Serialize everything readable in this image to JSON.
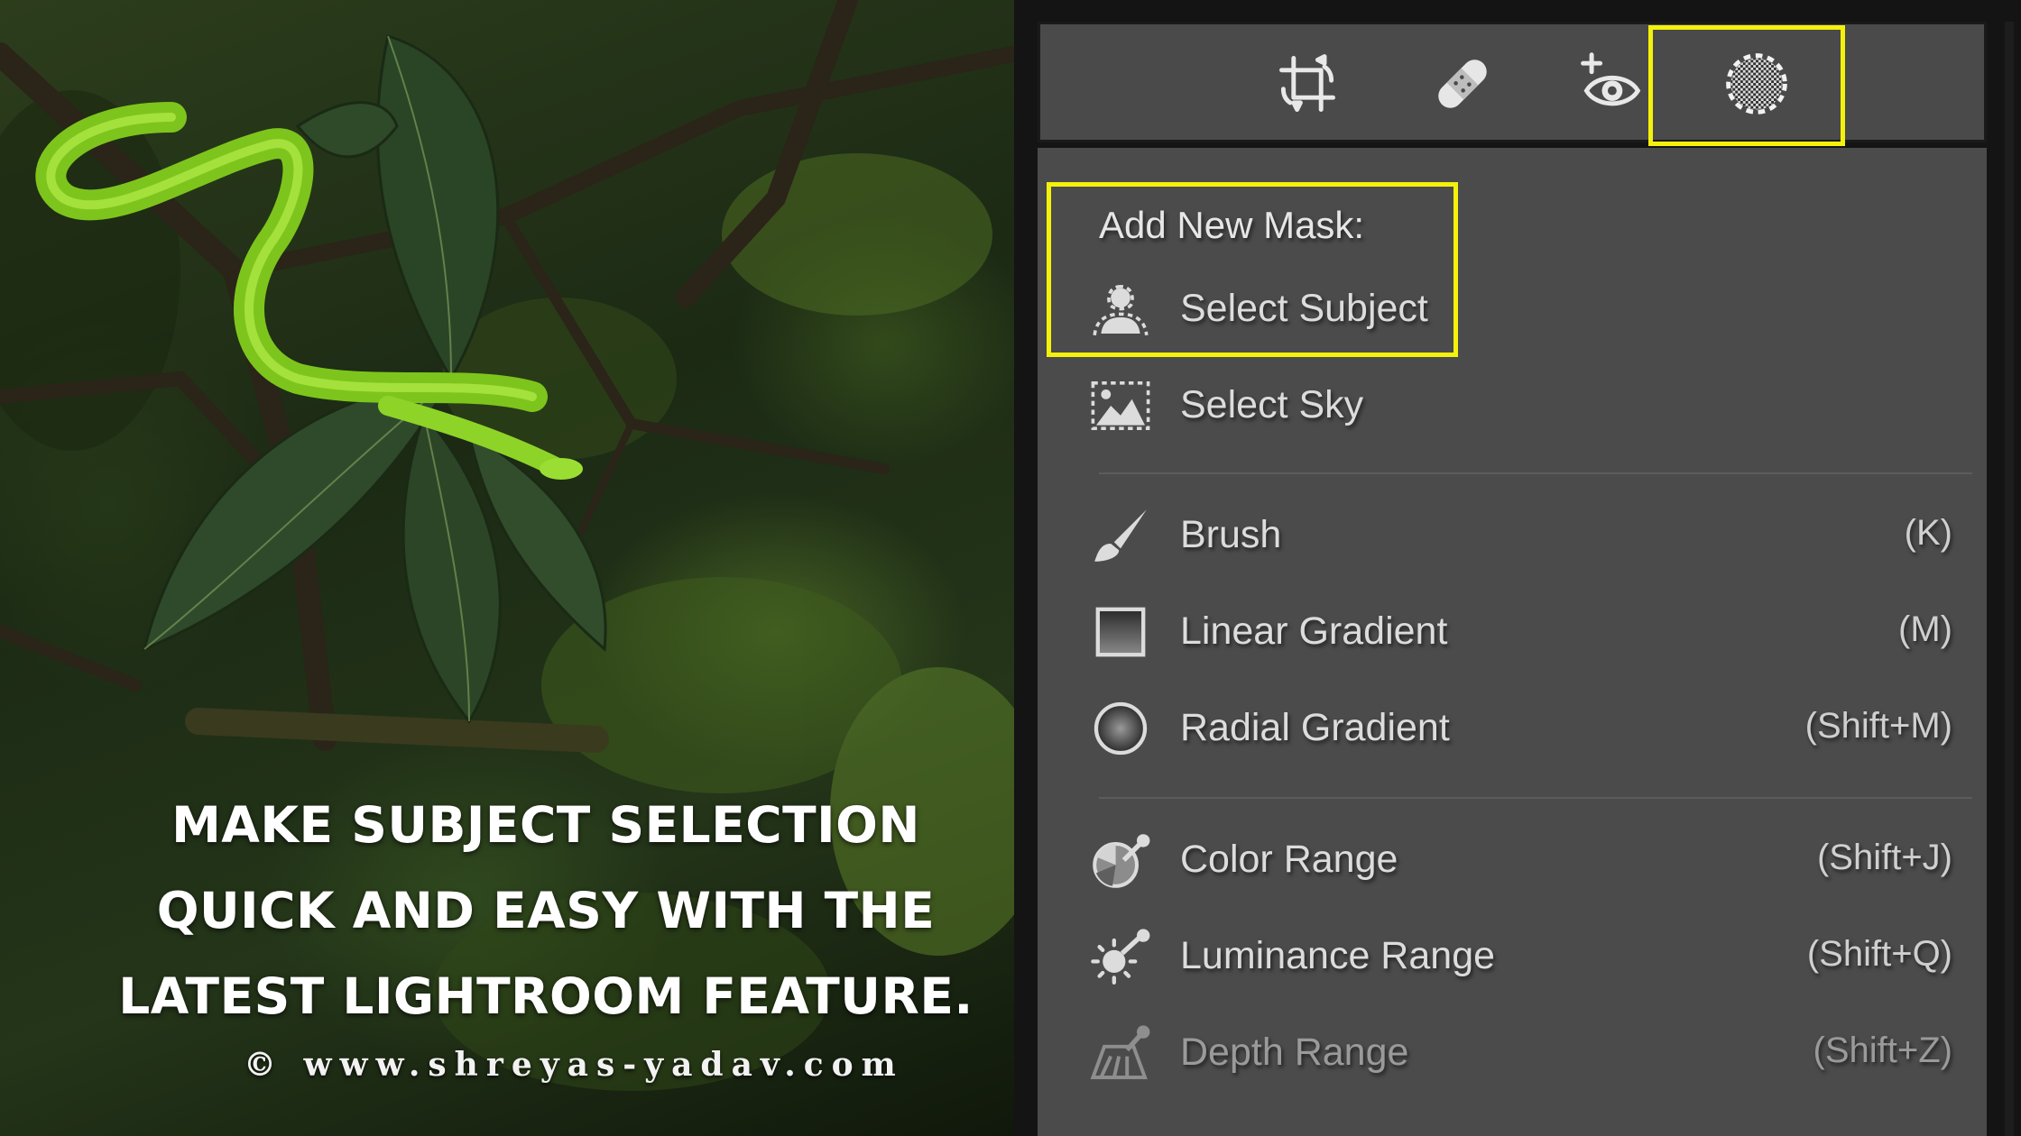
{
  "photo": {
    "caption_lines": [
      "MAKE SUBJECT SELECTION",
      "QUICK AND EASY WITH THE",
      "LATEST LIGHTROOM FEATURE."
    ],
    "copyright": "© www.shreyas-yadav.com"
  },
  "panel": {
    "toolbar": {
      "tools": [
        {
          "name": "crop",
          "icon": "crop-icon"
        },
        {
          "name": "healing",
          "icon": "bandage-icon"
        },
        {
          "name": "red-eye",
          "icon": "red-eye-icon"
        },
        {
          "name": "masking",
          "icon": "masking-icon",
          "active": true
        }
      ]
    },
    "heading": "Add New Mask:",
    "items": [
      {
        "label": "Select Subject",
        "shortcut": "",
        "icon": "select-subject-icon"
      },
      {
        "label": "Select Sky",
        "shortcut": "",
        "icon": "select-sky-icon"
      },
      {
        "label": "Brush",
        "shortcut": "(K)",
        "icon": "brush-icon"
      },
      {
        "label": "Linear Gradient",
        "shortcut": "(M)",
        "icon": "linear-gradient-icon"
      },
      {
        "label": "Radial Gradient",
        "shortcut": "(Shift+M)",
        "icon": "radial-gradient-icon"
      },
      {
        "label": "Color Range",
        "shortcut": "(Shift+J)",
        "icon": "color-range-icon"
      },
      {
        "label": "Luminance Range",
        "shortcut": "(Shift+Q)",
        "icon": "luminance-range-icon"
      },
      {
        "label": "Depth Range",
        "shortcut": "(Shift+Z)",
        "icon": "depth-range-icon",
        "disabled": true
      }
    ],
    "highlight_color": "#f4f10c"
  }
}
